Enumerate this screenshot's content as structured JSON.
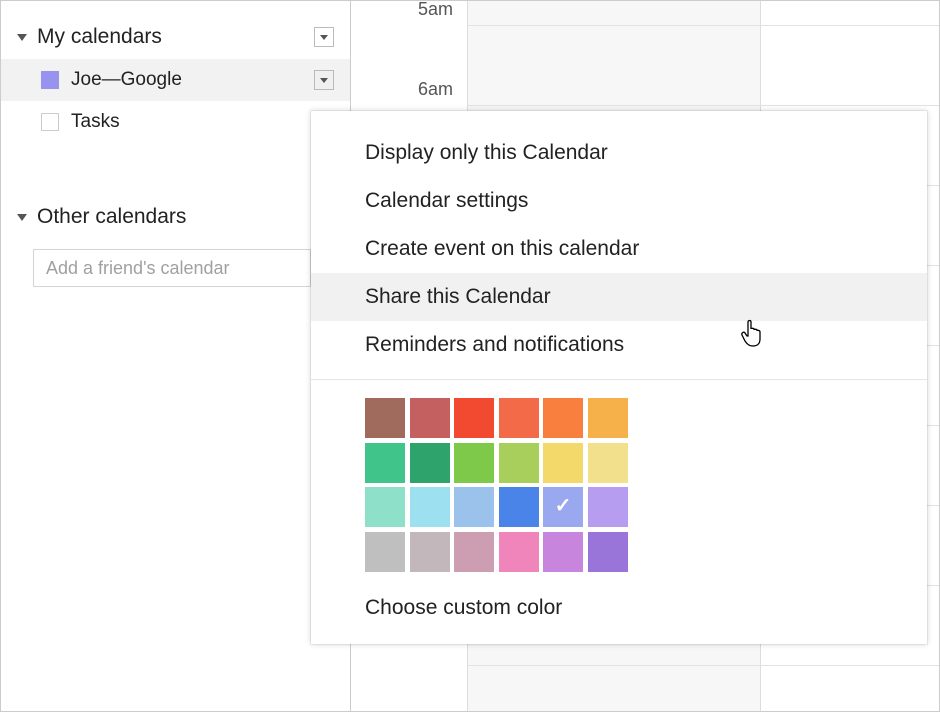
{
  "sidebar": {
    "myCalendars": {
      "title": "My calendars",
      "items": [
        {
          "label": "Joe—Google",
          "color": "#9793ee",
          "selected": true
        },
        {
          "label": "Tasks",
          "color": "",
          "selected": false,
          "outline": true
        }
      ]
    },
    "otherCalendars": {
      "title": "Other calendars",
      "addPlaceholder": "Add a friend's calendar"
    }
  },
  "timeline": {
    "hours": [
      "5am",
      "6am"
    ]
  },
  "popup": {
    "items": [
      {
        "label": "Display only this Calendar",
        "hovered": false
      },
      {
        "label": "Calendar settings",
        "hovered": false
      },
      {
        "label": "Create event on this calendar",
        "hovered": false
      },
      {
        "label": "Share this Calendar",
        "hovered": true
      },
      {
        "label": "Reminders and notifications",
        "hovered": false
      }
    ],
    "customColorLabel": "Choose custom color",
    "colors": [
      "#a06a5c",
      "#c46060",
      "#f24a30",
      "#f26a48",
      "#f97f3f",
      "#f6b14a",
      "#40c48a",
      "#2ea36b",
      "#7ec949",
      "#a8ce5c",
      "#f2d96a",
      "#f2e08c",
      "#8ee0c8",
      "#9de0ef",
      "#9ac2ea",
      "#4a84e8",
      "#9aa8ef",
      "#b79df0",
      "#bfbfbf",
      "#c2b8bb",
      "#cd9db2",
      "#ef85ba",
      "#c885de",
      "#9a75d9"
    ],
    "selectedColorIndex": 16
  }
}
